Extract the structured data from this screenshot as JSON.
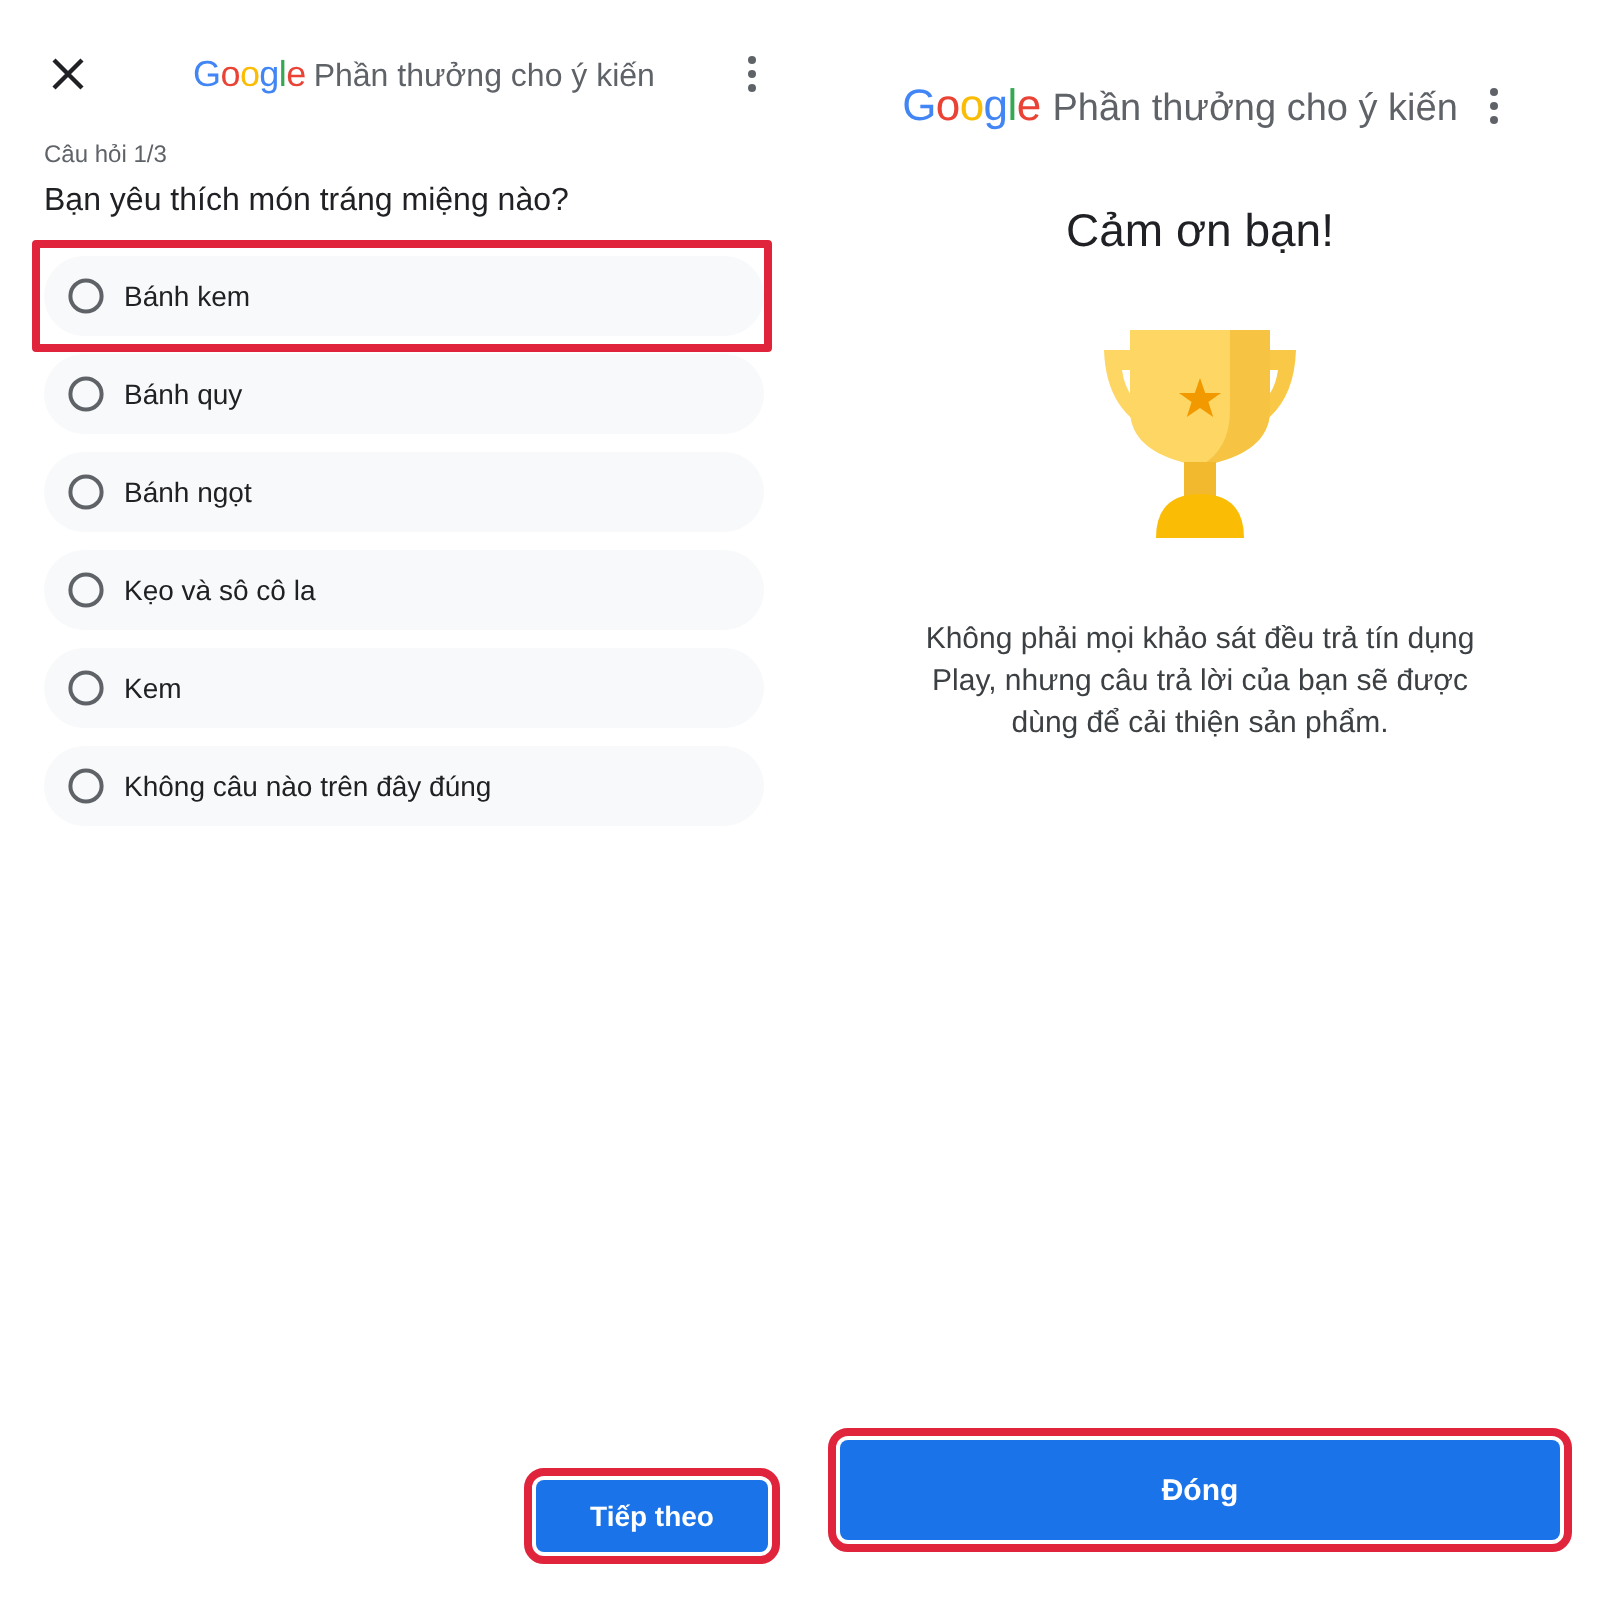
{
  "survey_screen": {
    "header": {
      "logo": "Google",
      "title": "Phần thưởng cho ý kiến"
    },
    "progress": "Câu hỏi 1/3",
    "question": "Bạn yêu thích món tráng miệng nào?",
    "options": [
      {
        "label": "Bánh kem",
        "selected": false,
        "highlighted": true
      },
      {
        "label": "Bánh quy",
        "selected": false,
        "highlighted": false
      },
      {
        "label": "Bánh ngọt",
        "selected": false,
        "highlighted": false
      },
      {
        "label": "Kẹo và sô cô la",
        "selected": false,
        "highlighted": false
      },
      {
        "label": "Kem",
        "selected": false,
        "highlighted": false
      },
      {
        "label": "Không câu nào trên đây đúng",
        "selected": false,
        "highlighted": false
      }
    ],
    "next_button": {
      "label": "Tiếp theo",
      "highlighted": true
    }
  },
  "thanks_screen": {
    "header": {
      "logo": "Google",
      "title": "Phần thưởng cho ý kiến"
    },
    "title": "Cảm ơn bạn!",
    "message": "Không phải mọi khảo sát đều trả tín dụng Play, nhưng câu trả lời của bạn sẽ được dùng để cải thiện sản phẩm.",
    "close_button": {
      "label": "Đóng",
      "highlighted": true
    }
  }
}
